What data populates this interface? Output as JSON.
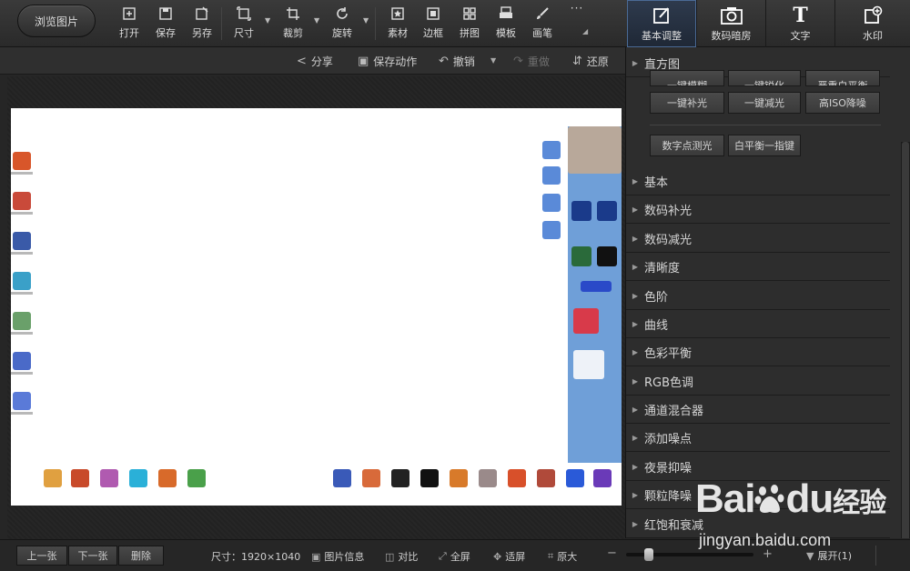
{
  "toolbar": {
    "browse_label": "浏览图片",
    "tools": [
      {
        "label": "打开",
        "icon": "open-icon"
      },
      {
        "label": "保存",
        "icon": "save-icon"
      },
      {
        "label": "另存",
        "icon": "save-as-icon"
      },
      {
        "label": "尺寸",
        "icon": "resize-icon"
      },
      {
        "label": "裁剪",
        "icon": "crop-icon"
      },
      {
        "label": "旋转",
        "icon": "rotate-icon"
      },
      {
        "label": "素材",
        "icon": "material-icon"
      },
      {
        "label": "边框",
        "icon": "border-icon"
      },
      {
        "label": "拼图",
        "icon": "collage-icon"
      },
      {
        "label": "模板",
        "icon": "template-icon"
      },
      {
        "label": "画笔",
        "icon": "brush-icon"
      },
      {
        "label": "···",
        "icon": "more-icon"
      }
    ]
  },
  "panel_tabs": [
    {
      "label": "基本调整",
      "icon": "adjust-icon",
      "active": true
    },
    {
      "label": "数码暗房",
      "icon": "darkroom-icon",
      "active": false
    },
    {
      "label": "文字",
      "icon": "text-icon",
      "active": false
    },
    {
      "label": "水印",
      "icon": "watermark-icon",
      "active": false
    }
  ],
  "subbar": {
    "share": "分享",
    "save_action": "保存动作",
    "undo": "撤销",
    "redo": "重做",
    "restore": "还原"
  },
  "panel": {
    "histogram": "直方图",
    "row0": [
      "一键模糊",
      "一键锐化",
      "严重白平衡"
    ],
    "row1": [
      "一键补光",
      "一键减光",
      "高ISO降噪"
    ],
    "row2": [
      "数字点测光",
      "白平衡一指键"
    ],
    "sections": [
      "基本",
      "数码补光",
      "数码减光",
      "清晰度",
      "色阶",
      "曲线",
      "色彩平衡",
      "RGB色调",
      "通道混合器",
      "添加噪点",
      "夜景抑噪",
      "颗粒降噪",
      "红饱和衰减"
    ]
  },
  "status": {
    "prev": "上一张",
    "next": "下一张",
    "delete": "删除",
    "size": "尺寸：1920×1040",
    "info": "图片信息",
    "compare": "对比",
    "fullscreen": "全屏",
    "fit": "适屏",
    "original": "原大",
    "zoom_minus": "−",
    "zoom_plus": "+",
    "zoom_level": 0.15,
    "expand": "展开(1)"
  },
  "watermark": {
    "logo_text": "Bai",
    "logo_text2": "du",
    "logo_cn": "经验",
    "url": "jingyan.baidu.com"
  },
  "colors": {
    "active_tab_border": "#4a6a95",
    "photo_bg": "#ffffff",
    "taskbar_blue": "#6f9fd8"
  }
}
